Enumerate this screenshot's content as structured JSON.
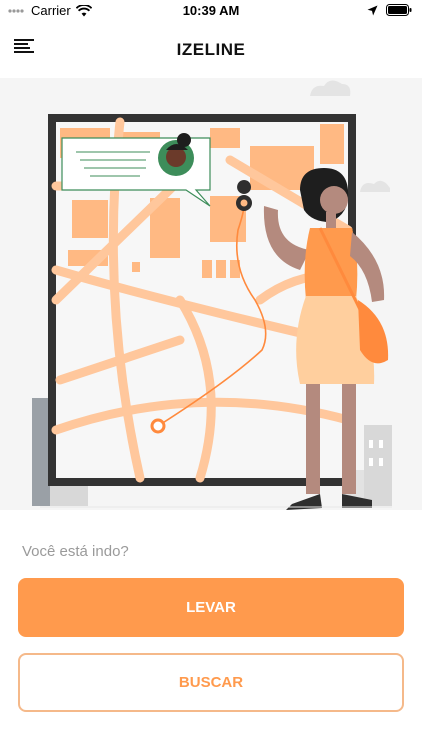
{
  "status_bar": {
    "carrier": "Carrier",
    "time": "10:39 AM"
  },
  "header": {
    "title": "IZELINE"
  },
  "main": {
    "question": "Você está indo?",
    "primary_button": "LEVAR",
    "secondary_button": "BUSCAR"
  },
  "colors": {
    "accent": "#ff9a4d",
    "accent_light": "#f5b98a"
  },
  "icons": [
    "signal-dots-icon",
    "wifi-icon",
    "location-arrow-icon",
    "battery-icon",
    "menu-icon"
  ]
}
